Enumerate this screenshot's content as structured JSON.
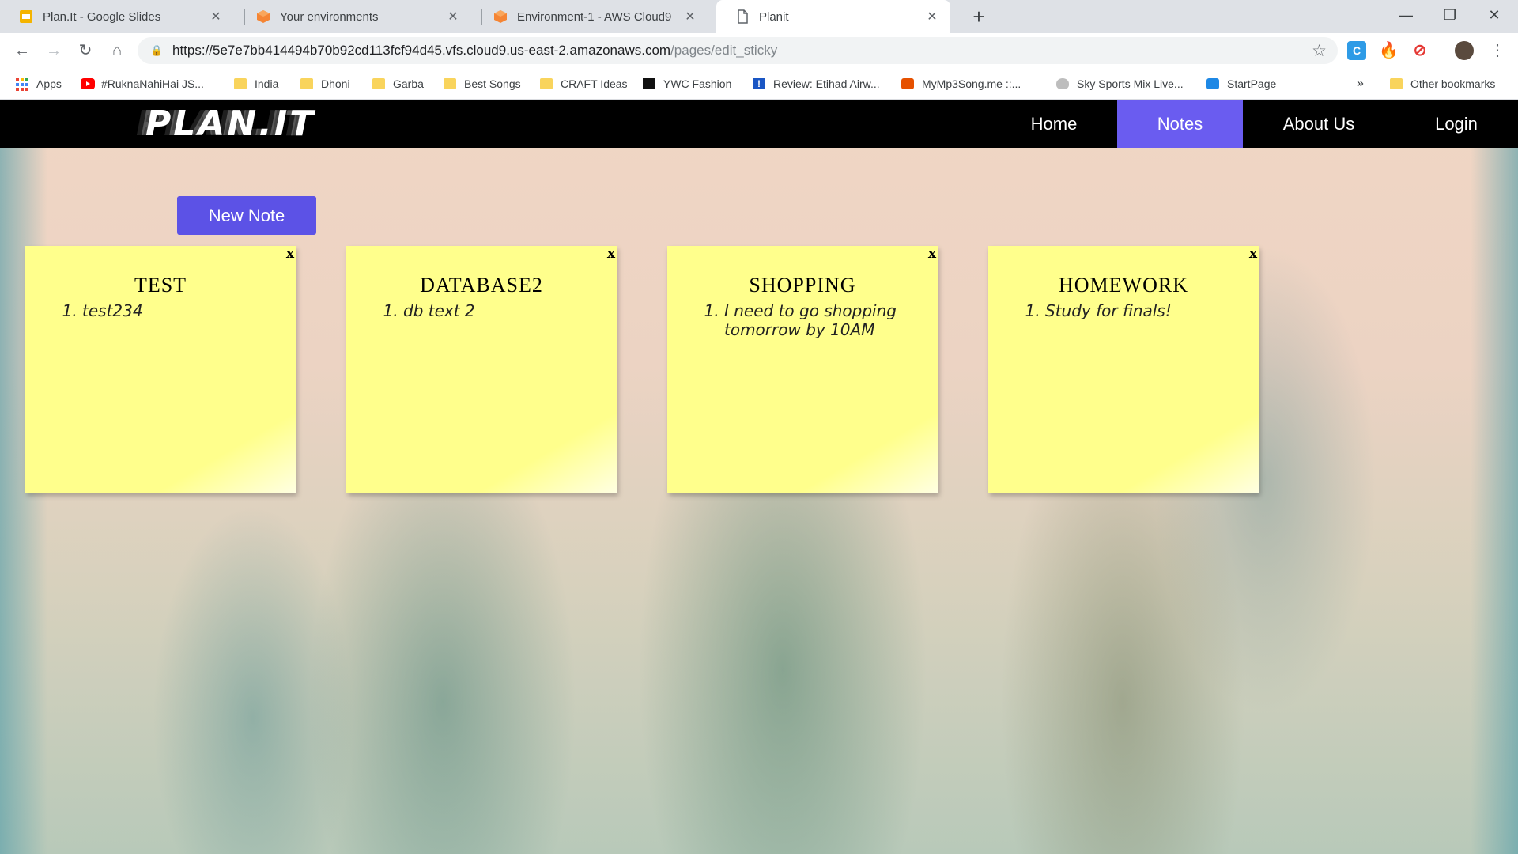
{
  "browser": {
    "tabs": [
      {
        "title": "Plan.It - Google Slides",
        "icon": "google-slides-icon"
      },
      {
        "title": "Your environments",
        "icon": "aws-cloud9-icon"
      },
      {
        "title": "Environment-1 - AWS Cloud9",
        "icon": "aws-cloud9-icon"
      },
      {
        "title": "Planit",
        "icon": "page-icon"
      }
    ],
    "url_host": "https://5e7e7bb414494b70b92cd113fcf94d45.vfs.cloud9.us-east-2.amazonaws.com",
    "url_path": "/pages/edit_sticky",
    "bookmarks": [
      {
        "label": "Apps",
        "icon": "apps-grid-icon"
      },
      {
        "label": "#RuknaNahiHai JS...",
        "icon": "youtube-icon"
      },
      {
        "label": "India",
        "icon": "folder-icon"
      },
      {
        "label": "Dhoni",
        "icon": "folder-icon"
      },
      {
        "label": "Garba",
        "icon": "folder-icon"
      },
      {
        "label": "Best Songs",
        "icon": "folder-icon"
      },
      {
        "label": "CRAFT Ideas",
        "icon": "folder-icon"
      },
      {
        "label": "YWC Fashion",
        "icon": "ywc-icon"
      },
      {
        "label": "Review: Etihad Airw...",
        "icon": "alert-icon"
      },
      {
        "label": "MyMp3Song.me ::...",
        "icon": "music-icon"
      },
      {
        "label": "Sky Sports Mix Live...",
        "icon": "bulb-icon"
      },
      {
        "label": "StartPage",
        "icon": "startpage-icon"
      }
    ],
    "bookmarks_overflow": "»",
    "other_bookmarks": "Other bookmarks"
  },
  "site": {
    "logo": "PLAN.IT",
    "nav": {
      "home": "Home",
      "notes": "Notes",
      "about": "About Us",
      "login": "Login"
    },
    "new_note_label": "New Note",
    "notes": [
      {
        "title": "TEST",
        "items": [
          "test234"
        ],
        "close": "x"
      },
      {
        "title": "DATABASE2",
        "items": [
          "db text 2"
        ],
        "close": "x"
      },
      {
        "title": "SHOPPING",
        "items": [
          "I need to go shopping tomorrow by 10AM"
        ],
        "close": "x"
      },
      {
        "title": "HOMEWORK",
        "items": [
          "Study for finals!"
        ],
        "close": "x"
      }
    ]
  }
}
